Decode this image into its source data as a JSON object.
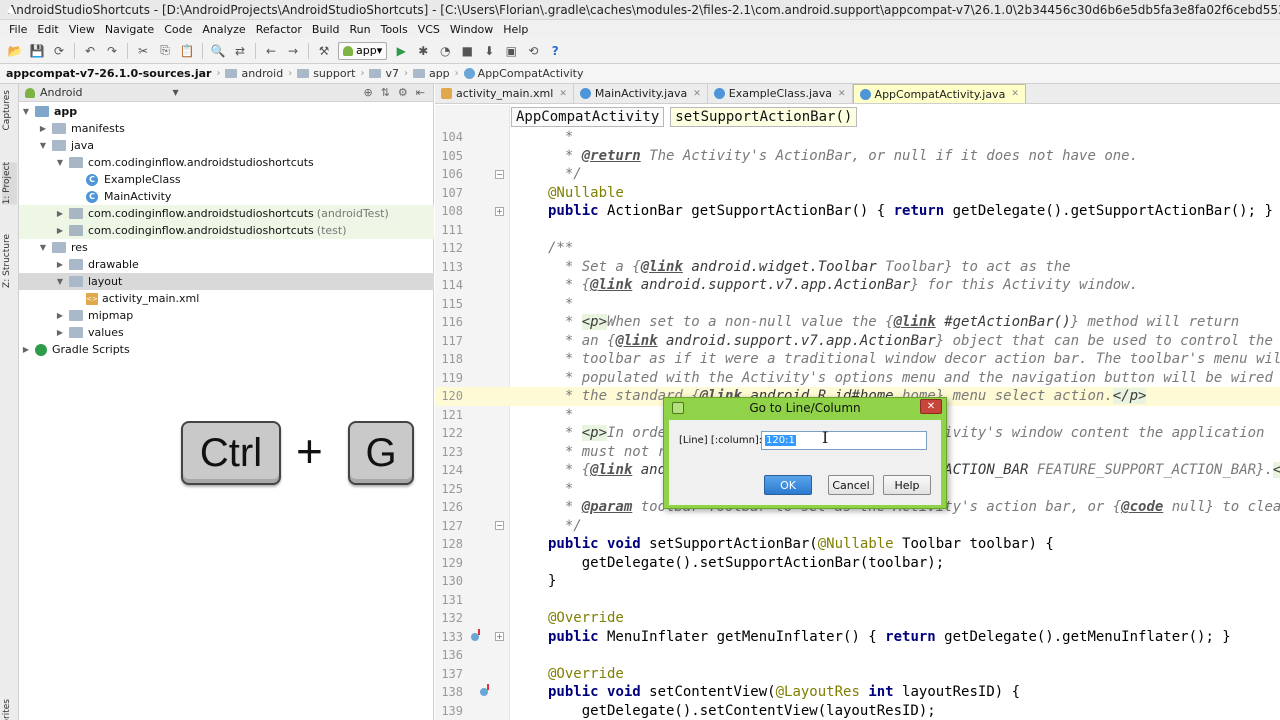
{
  "window": {
    "title": "AndroidStudioShortcuts - [D:\\AndroidProjects\\AndroidStudioShortcuts] - [C:\\Users\\Florian\\.gradle\\caches\\modules-2\\files-2.1\\com.android.support\\appcompat-v7\\26.1.0\\2b34456c30d6b6e5db5fa3e8fa02f6cebd5531fd\\appcom"
  },
  "menu": [
    "File",
    "Edit",
    "View",
    "Navigate",
    "Code",
    "Analyze",
    "Refactor",
    "Build",
    "Run",
    "Tools",
    "VCS",
    "Window",
    "Help"
  ],
  "toolbar": {
    "run_config": "app",
    "icons": [
      "open-icon",
      "save-icon",
      "sync-icon",
      "undo-icon",
      "redo-icon",
      "cut-icon",
      "copy-icon",
      "paste-icon",
      "find-icon",
      "replace-icon",
      "back-icon",
      "forward-icon",
      "build-icon",
      "run-icon",
      "debug-icon",
      "profile-icon",
      "stop-icon",
      "sdk-manager-icon",
      "avd-manager-icon",
      "gradle-sync-icon",
      "help-icon"
    ]
  },
  "navbar": {
    "crumbs": [
      "appcompat-v7-26.1.0-sources.jar",
      "android",
      "support",
      "v7",
      "app",
      "AppCompatActivity"
    ]
  },
  "toolstrip": {
    "tabs": [
      "Captures",
      "1: Project",
      "Z: Structure",
      "Favorites"
    ]
  },
  "project_panel": {
    "view_selector": "Android",
    "tree": [
      {
        "label": "app",
        "suffix": "",
        "depth": 0,
        "icon": "module",
        "expanded": true
      },
      {
        "label": "manifests",
        "suffix": "",
        "depth": 1,
        "icon": "folder",
        "expanded": false
      },
      {
        "label": "java",
        "suffix": "",
        "depth": 1,
        "icon": "folder",
        "expanded": true
      },
      {
        "label": "com.codinginflow.androidstudioshortcuts",
        "suffix": "",
        "depth": 2,
        "icon": "package",
        "expanded": true
      },
      {
        "label": "ExampleClass",
        "suffix": "",
        "depth": 3,
        "icon": "class"
      },
      {
        "label": "MainActivity",
        "suffix": "",
        "depth": 3,
        "icon": "class"
      },
      {
        "label": "com.codinginflow.androidstudioshortcuts",
        "suffix": "(androidTest)",
        "depth": 2,
        "icon": "package",
        "expanded": false
      },
      {
        "label": "com.codinginflow.androidstudioshortcuts",
        "suffix": "(test)",
        "depth": 2,
        "icon": "package",
        "expanded": false
      },
      {
        "label": "res",
        "suffix": "",
        "depth": 1,
        "icon": "folder",
        "expanded": true
      },
      {
        "label": "drawable",
        "suffix": "",
        "depth": 2,
        "icon": "folder",
        "expanded": false
      },
      {
        "label": "layout",
        "suffix": "",
        "depth": 2,
        "icon": "folder",
        "expanded": true
      },
      {
        "label": "activity_main.xml",
        "suffix": "",
        "depth": 3,
        "icon": "xml"
      },
      {
        "label": "mipmap",
        "suffix": "",
        "depth": 2,
        "icon": "folder",
        "expanded": false
      },
      {
        "label": "values",
        "suffix": "",
        "depth": 2,
        "icon": "folder",
        "expanded": false
      },
      {
        "label": "Gradle Scripts",
        "suffix": "",
        "depth": 0,
        "icon": "gradle",
        "expanded": false
      }
    ]
  },
  "shortcut_overlay": {
    "key1": "Ctrl",
    "plus": "+",
    "key2": "G"
  },
  "editor_tabs": [
    {
      "label": "activity_main.xml",
      "type": "xml",
      "active": false
    },
    {
      "label": "MainActivity.java",
      "type": "class",
      "active": false
    },
    {
      "label": "ExampleClass.java",
      "type": "class",
      "active": false
    },
    {
      "label": "AppCompatActivity.java",
      "type": "class",
      "active": true
    }
  ],
  "editor": {
    "breadcrumb": [
      "AppCompatActivity",
      "setSupportActionBar()"
    ],
    "lines": [
      {
        "n": "104",
        "text": "  *"
      },
      {
        "n": "105",
        "text": "  * @return The Activity's ActionBar, or null if it does not have one."
      },
      {
        "n": "106",
        "text": "  */"
      },
      {
        "n": "107",
        "text": "@Nullable"
      },
      {
        "n": "108",
        "text": "public ActionBar getSupportActionBar() { return getDelegate().getSupportActionBar(); }"
      },
      {
        "n": "111",
        "text": ""
      },
      {
        "n": "112",
        "text": "/**"
      },
      {
        "n": "113",
        "text": "  * Set a {@link android.widget.Toolbar Toolbar} to act as the"
      },
      {
        "n": "114",
        "text": "  * {@link android.support.v7.app.ActionBar} for this Activity window."
      },
      {
        "n": "115",
        "text": "  *"
      },
      {
        "n": "116",
        "text": "  * <p>When set to a non-null value the {@link #getActionBar()} method will return"
      },
      {
        "n": "117",
        "text": "  * an {@link android.support.v7.app.ActionBar} object that can be used to control the g"
      },
      {
        "n": "118",
        "text": "  * toolbar as if it were a traditional window decor action bar. The toolbar's menu will"
      },
      {
        "n": "119",
        "text": "  * populated with the Activity's options menu and the navigation button will be wired t"
      },
      {
        "n": "120",
        "text": "  * the standard {@link android.R.id#home home} menu select action.</p>"
      },
      {
        "n": "121",
        "text": "  *"
      },
      {
        "n": "122",
        "text": "  * <p>In order to use a Toolbar within the Activity's window content the application"
      },
      {
        "n": "123",
        "text": "  * must not request the window feature"
      },
      {
        "n": "124",
        "text": "  * {@link android.view.Window#FEATURE_SUPPORT_ACTION_BAR FEATURE_SUPPORT_ACTION_BAR}.</p>"
      },
      {
        "n": "125",
        "text": "  *"
      },
      {
        "n": "126",
        "text": "  * @param toolbar Toolbar to set as the Activity's action bar, or {@code null} to clear"
      },
      {
        "n": "127",
        "text": "  */"
      },
      {
        "n": "128",
        "text": "public void setSupportActionBar(@Nullable Toolbar toolbar) {"
      },
      {
        "n": "129",
        "text": "    getDelegate().setSupportActionBar(toolbar);"
      },
      {
        "n": "130",
        "text": "}"
      },
      {
        "n": "131",
        "text": ""
      },
      {
        "n": "132",
        "text": "@Override"
      },
      {
        "n": "133",
        "text": "public MenuInflater getMenuInflater() { return getDelegate().getMenuInflater(); }"
      },
      {
        "n": "136",
        "text": ""
      },
      {
        "n": "137",
        "text": "@Override"
      },
      {
        "n": "138",
        "text": "public void setContentView(@LayoutRes int layoutResID) {"
      },
      {
        "n": "139",
        "text": "    getDelegate().setContentView(layoutResID);"
      }
    ],
    "current_line": "120"
  },
  "dialog": {
    "title": "Go to Line/Column",
    "label": "[Line] [:column]:",
    "value": "120:1",
    "ok_label": "OK",
    "cancel_label": "Cancel",
    "help_label": "Help",
    "close_glyph": "✕"
  }
}
